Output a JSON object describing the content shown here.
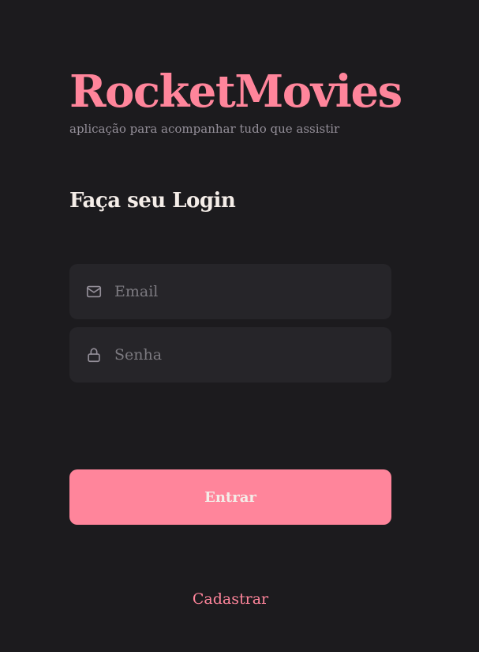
{
  "brand": {
    "title": "RocketMovies",
    "tagline": "aplicação para acompanhar tudo que assistir"
  },
  "form": {
    "title": "Faça seu Login",
    "email": {
      "icon": "mail-icon",
      "placeholder": "Email",
      "value": ""
    },
    "password": {
      "icon": "lock-icon",
      "placeholder": "Senha",
      "value": ""
    },
    "submit_label": "Entrar"
  },
  "signup_link": "Cadastrar",
  "colors": {
    "background": "#1c1b1e",
    "accent": "#ff859b",
    "input_background": "#262529",
    "text_primary": "#f4ede8",
    "text_muted": "#948f99"
  }
}
